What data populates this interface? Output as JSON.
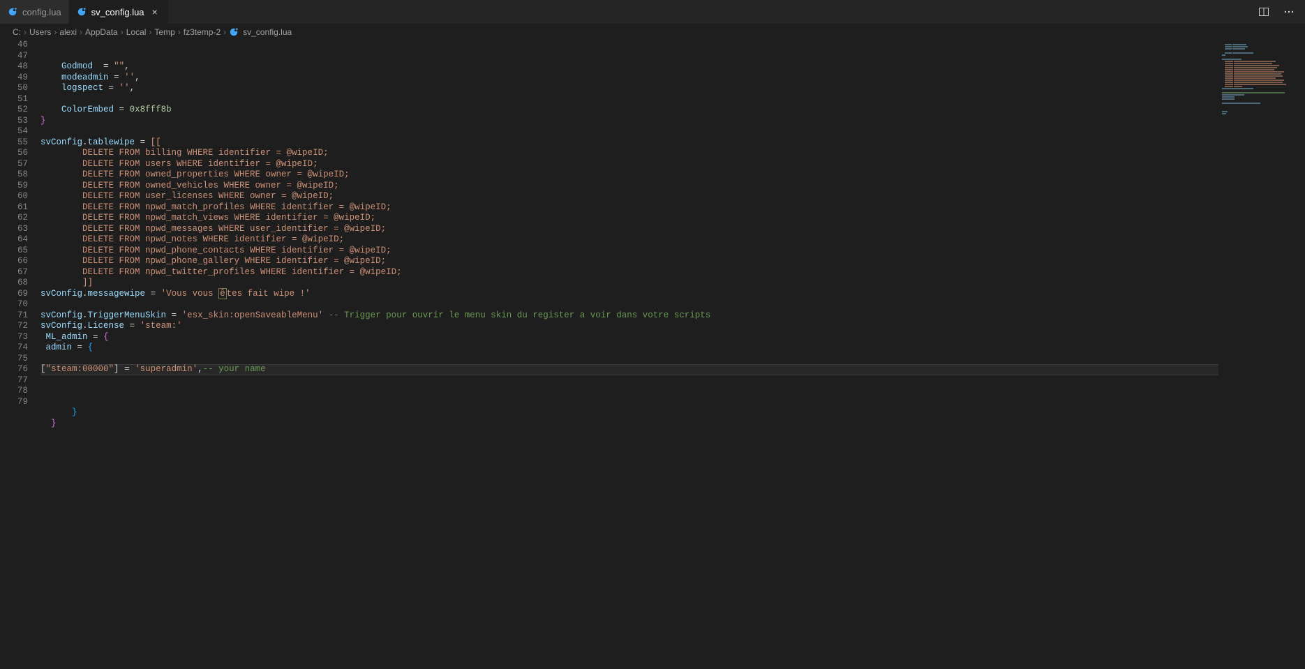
{
  "tabs": [
    {
      "name": "config.lua",
      "active": false,
      "modified": false
    },
    {
      "name": "sv_config.lua",
      "active": true,
      "modified": false
    }
  ],
  "breadcrumb": {
    "parts": [
      "C:",
      "Users",
      "alexi",
      "AppData",
      "Local",
      "Temp",
      "fz3temp-2"
    ],
    "file": "sv_config.lua"
  },
  "editor": {
    "startLine": 46,
    "currentLine": 76,
    "lines": [
      {
        "n": 46,
        "html": "    <span class='tok-prop'>Godmod</span>  <span class='tok-op'>=</span> <span class='tok-str'>\"\"</span><span class='tok-op'>,</span>"
      },
      {
        "n": 47,
        "html": "    <span class='tok-prop'>modeadmin</span> <span class='tok-op'>=</span> <span class='tok-str'>''</span><span class='tok-op'>,</span>"
      },
      {
        "n": 48,
        "html": "    <span class='tok-prop'>logspect</span> <span class='tok-op'>=</span> <span class='tok-str'>''</span><span class='tok-op'>,</span>"
      },
      {
        "n": 49,
        "html": ""
      },
      {
        "n": 50,
        "html": "    <span class='tok-prop'>ColorEmbed</span> <span class='tok-op'>=</span> <span class='tok-num'>0x8fff8b</span>"
      },
      {
        "n": 51,
        "html": "<span class='tok-brace'>}</span>"
      },
      {
        "n": 52,
        "html": ""
      },
      {
        "n": 53,
        "html": "<span class='tok-var'>svConfig</span><span class='tok-op'>.</span><span class='tok-prop'>tablewipe</span> <span class='tok-op'>=</span> <span class='tok-str'>[[</span>"
      },
      {
        "n": 54,
        "html": "<span class='tok-str'>        DELETE FROM billing WHERE identifier = @wipeID;</span>"
      },
      {
        "n": 55,
        "html": "<span class='tok-str'>        DELETE FROM users WHERE identifier = @wipeID;</span>"
      },
      {
        "n": 56,
        "html": "<span class='tok-str'>        DELETE FROM owned_properties WHERE owner = @wipeID;</span>"
      },
      {
        "n": 57,
        "html": "<span class='tok-str'>        DELETE FROM owned_vehicles WHERE owner = @wipeID;</span>"
      },
      {
        "n": 58,
        "html": "<span class='tok-str'>        DELETE FROM user_licenses WHERE owner = @wipeID;</span>"
      },
      {
        "n": 59,
        "html": "<span class='tok-str'>        DELETE FROM npwd_match_profiles WHERE identifier = @wipeID;</span>"
      },
      {
        "n": 60,
        "html": "<span class='tok-str'>        DELETE FROM npwd_match_views WHERE identifier = @wipeID;</span>"
      },
      {
        "n": 61,
        "html": "<span class='tok-str'>        DELETE FROM npwd_messages WHERE user_identifier = @wipeID;</span>"
      },
      {
        "n": 62,
        "html": "<span class='tok-str'>        DELETE FROM npwd_notes WHERE identifier = @wipeID;</span>"
      },
      {
        "n": 63,
        "html": "<span class='tok-str'>        DELETE FROM npwd_phone_contacts WHERE identifier = @wipeID;</span>"
      },
      {
        "n": 64,
        "html": "<span class='tok-str'>        DELETE FROM npwd_phone_gallery WHERE identifier = @wipeID;</span>"
      },
      {
        "n": 65,
        "html": "<span class='tok-str'>        DELETE FROM npwd_twitter_profiles WHERE identifier = @wipeID;</span>"
      },
      {
        "n": 66,
        "html": "<span class='tok-str'>        ]]</span>"
      },
      {
        "n": 67,
        "html": "<span class='tok-var'>svConfig</span><span class='tok-op'>.</span><span class='tok-prop'>messagewipe</span> <span class='tok-op'>=</span> <span class='tok-str'>'Vous vous <span class=\"hlbox\">ê</span>tes fait wipe !'</span>"
      },
      {
        "n": 68,
        "html": ""
      },
      {
        "n": 69,
        "html": "<span class='tok-var'>svConfig</span><span class='tok-op'>.</span><span class='tok-prop'>TriggerMenuSkin</span> <span class='tok-op'>=</span> <span class='tok-str'>'esx_skin:openSaveableMenu'</span> <span class='tok-comment'>-- Trigger pour ouvrir le menu skin du register a voir dans votre scripts</span>"
      },
      {
        "n": 70,
        "html": "<span class='tok-var'>svConfig</span><span class='tok-op'>.</span><span class='tok-prop'>License</span> <span class='tok-op'>=</span> <span class='tok-str'>'steam:'</span>"
      },
      {
        "n": 71,
        "html": " <span class='tok-prop'>ML_admin</span> <span class='tok-op'>=</span> <span class='tok-brace'>{</span>"
      },
      {
        "n": 72,
        "html": " <span class='tok-prop'>admin</span> <span class='tok-op'>=</span> <span class='tok-brace2'>{</span>"
      },
      {
        "n": 73,
        "html": ""
      },
      {
        "n": 74,
        "html": "<span class='tok-op'>[</span><span class='tok-str'>\"steam:00000\"</span><span class='tok-op'>]</span> <span class='tok-op'>=</span> <span class='tok-str'>'superadmin'</span><span class='tok-op'>,</span><span class='tok-comment'>-- your name</span>"
      },
      {
        "n": 75,
        "html": ""
      },
      {
        "n": 76,
        "html": ""
      },
      {
        "n": 77,
        "html": ""
      },
      {
        "n": 78,
        "html": "      <span class='tok-brace2'>}</span>"
      },
      {
        "n": 79,
        "html": "  <span class='tok-brace'>}</span>"
      }
    ]
  },
  "icons": {
    "split": "split-editor-icon",
    "more": "more-icon"
  }
}
